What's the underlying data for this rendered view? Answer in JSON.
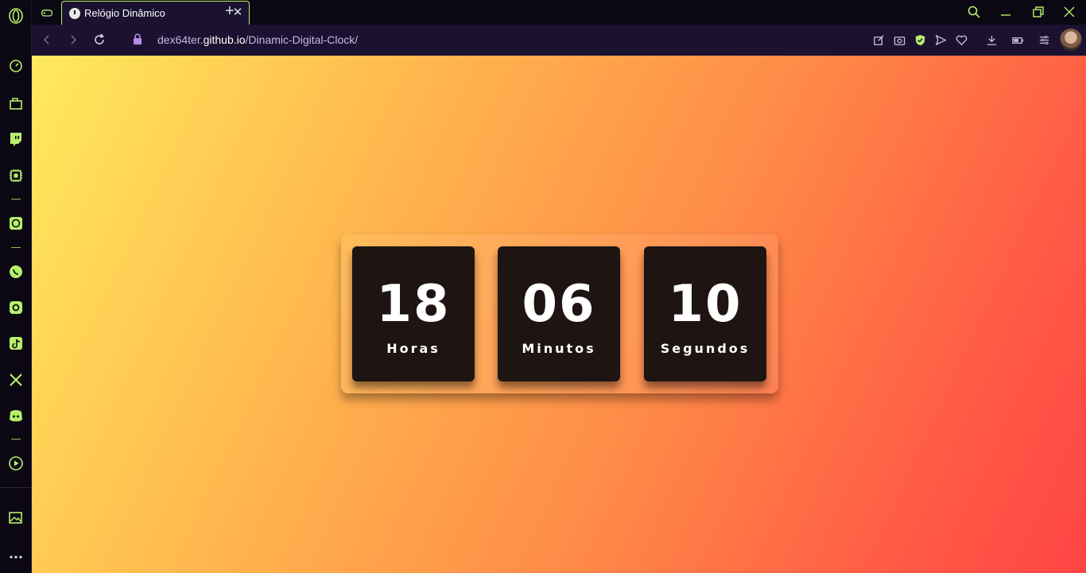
{
  "browser": {
    "tab": {
      "title": "Relógio Dinâmico"
    },
    "address": {
      "url_prefix": "dex64ter.",
      "url_domain": "github.io",
      "url_path": "/Dinamic-Digital-Clock/"
    }
  },
  "sidebar": {
    "items": [
      "speed-dial",
      "inventory",
      "twitch",
      "cpu",
      "chatgpt",
      "whatsapp",
      "instagram",
      "tiktok",
      "x",
      "discord",
      "player",
      "gallery",
      "more"
    ]
  },
  "clock": {
    "hours": {
      "value": "18",
      "label": "Horas"
    },
    "minutes": {
      "value": "06",
      "label": "Minutos"
    },
    "seconds": {
      "value": "10",
      "label": "Segundos"
    }
  },
  "colors": {
    "accent": "#b7ef6a",
    "chrome_bg": "#0b0814",
    "toolbar_bg": "#1a1230",
    "card_bg": "#1e1512",
    "gradient": [
      "#ffea5c",
      "#ffb84f",
      "#ff8a47",
      "#ff5a45",
      "#ff4545"
    ]
  }
}
